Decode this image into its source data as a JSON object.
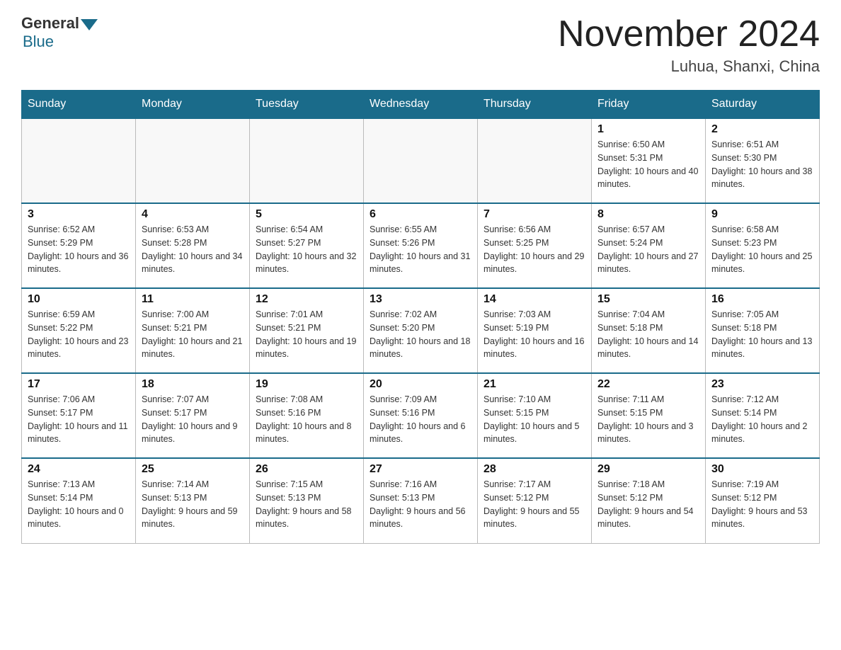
{
  "header": {
    "logo_general": "General",
    "logo_blue": "Blue",
    "main_title": "November 2024",
    "subtitle": "Luhua, Shanxi, China"
  },
  "days_of_week": [
    "Sunday",
    "Monday",
    "Tuesday",
    "Wednesday",
    "Thursday",
    "Friday",
    "Saturday"
  ],
  "weeks": [
    [
      {
        "day": "",
        "info": ""
      },
      {
        "day": "",
        "info": ""
      },
      {
        "day": "",
        "info": ""
      },
      {
        "day": "",
        "info": ""
      },
      {
        "day": "",
        "info": ""
      },
      {
        "day": "1",
        "info": "Sunrise: 6:50 AM\nSunset: 5:31 PM\nDaylight: 10 hours and 40 minutes."
      },
      {
        "day": "2",
        "info": "Sunrise: 6:51 AM\nSunset: 5:30 PM\nDaylight: 10 hours and 38 minutes."
      }
    ],
    [
      {
        "day": "3",
        "info": "Sunrise: 6:52 AM\nSunset: 5:29 PM\nDaylight: 10 hours and 36 minutes."
      },
      {
        "day": "4",
        "info": "Sunrise: 6:53 AM\nSunset: 5:28 PM\nDaylight: 10 hours and 34 minutes."
      },
      {
        "day": "5",
        "info": "Sunrise: 6:54 AM\nSunset: 5:27 PM\nDaylight: 10 hours and 32 minutes."
      },
      {
        "day": "6",
        "info": "Sunrise: 6:55 AM\nSunset: 5:26 PM\nDaylight: 10 hours and 31 minutes."
      },
      {
        "day": "7",
        "info": "Sunrise: 6:56 AM\nSunset: 5:25 PM\nDaylight: 10 hours and 29 minutes."
      },
      {
        "day": "8",
        "info": "Sunrise: 6:57 AM\nSunset: 5:24 PM\nDaylight: 10 hours and 27 minutes."
      },
      {
        "day": "9",
        "info": "Sunrise: 6:58 AM\nSunset: 5:23 PM\nDaylight: 10 hours and 25 minutes."
      }
    ],
    [
      {
        "day": "10",
        "info": "Sunrise: 6:59 AM\nSunset: 5:22 PM\nDaylight: 10 hours and 23 minutes."
      },
      {
        "day": "11",
        "info": "Sunrise: 7:00 AM\nSunset: 5:21 PM\nDaylight: 10 hours and 21 minutes."
      },
      {
        "day": "12",
        "info": "Sunrise: 7:01 AM\nSunset: 5:21 PM\nDaylight: 10 hours and 19 minutes."
      },
      {
        "day": "13",
        "info": "Sunrise: 7:02 AM\nSunset: 5:20 PM\nDaylight: 10 hours and 18 minutes."
      },
      {
        "day": "14",
        "info": "Sunrise: 7:03 AM\nSunset: 5:19 PM\nDaylight: 10 hours and 16 minutes."
      },
      {
        "day": "15",
        "info": "Sunrise: 7:04 AM\nSunset: 5:18 PM\nDaylight: 10 hours and 14 minutes."
      },
      {
        "day": "16",
        "info": "Sunrise: 7:05 AM\nSunset: 5:18 PM\nDaylight: 10 hours and 13 minutes."
      }
    ],
    [
      {
        "day": "17",
        "info": "Sunrise: 7:06 AM\nSunset: 5:17 PM\nDaylight: 10 hours and 11 minutes."
      },
      {
        "day": "18",
        "info": "Sunrise: 7:07 AM\nSunset: 5:17 PM\nDaylight: 10 hours and 9 minutes."
      },
      {
        "day": "19",
        "info": "Sunrise: 7:08 AM\nSunset: 5:16 PM\nDaylight: 10 hours and 8 minutes."
      },
      {
        "day": "20",
        "info": "Sunrise: 7:09 AM\nSunset: 5:16 PM\nDaylight: 10 hours and 6 minutes."
      },
      {
        "day": "21",
        "info": "Sunrise: 7:10 AM\nSunset: 5:15 PM\nDaylight: 10 hours and 5 minutes."
      },
      {
        "day": "22",
        "info": "Sunrise: 7:11 AM\nSunset: 5:15 PM\nDaylight: 10 hours and 3 minutes."
      },
      {
        "day": "23",
        "info": "Sunrise: 7:12 AM\nSunset: 5:14 PM\nDaylight: 10 hours and 2 minutes."
      }
    ],
    [
      {
        "day": "24",
        "info": "Sunrise: 7:13 AM\nSunset: 5:14 PM\nDaylight: 10 hours and 0 minutes."
      },
      {
        "day": "25",
        "info": "Sunrise: 7:14 AM\nSunset: 5:13 PM\nDaylight: 9 hours and 59 minutes."
      },
      {
        "day": "26",
        "info": "Sunrise: 7:15 AM\nSunset: 5:13 PM\nDaylight: 9 hours and 58 minutes."
      },
      {
        "day": "27",
        "info": "Sunrise: 7:16 AM\nSunset: 5:13 PM\nDaylight: 9 hours and 56 minutes."
      },
      {
        "day": "28",
        "info": "Sunrise: 7:17 AM\nSunset: 5:12 PM\nDaylight: 9 hours and 55 minutes."
      },
      {
        "day": "29",
        "info": "Sunrise: 7:18 AM\nSunset: 5:12 PM\nDaylight: 9 hours and 54 minutes."
      },
      {
        "day": "30",
        "info": "Sunrise: 7:19 AM\nSunset: 5:12 PM\nDaylight: 9 hours and 53 minutes."
      }
    ]
  ]
}
